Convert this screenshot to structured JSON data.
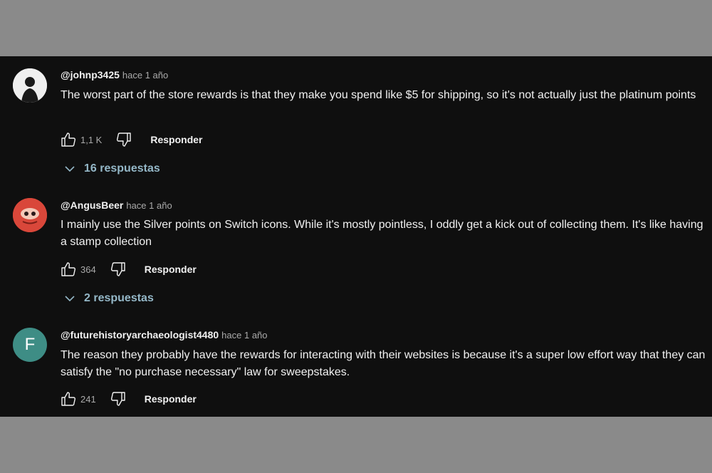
{
  "comments": [
    {
      "author": "@johnp3425",
      "time": "hace 1 año",
      "text": "The worst part of the store rewards is that they make you spend like $5 for shipping, so it's not actually just the platinum points",
      "likes": "1,1 K",
      "reply_label": "Responder",
      "replies_label": "16 respuestas"
    },
    {
      "author": "@AngusBeer",
      "time": "hace 1 año",
      "text": "I mainly use the Silver points on Switch icons. While it's mostly pointless, I oddly get a kick out of collecting them. It's like having a stamp collection",
      "likes": "364",
      "reply_label": "Responder",
      "replies_label": "2 respuestas"
    },
    {
      "author": "@futurehistoryarchaeologist4480",
      "time": "hace 1 año",
      "avatar_letter": "F",
      "text": "The reason they probably have the rewards for interacting with their websites is because it's a super low effort way that they can satisfy the \"no purchase necessary\" law for sweepstakes.",
      "likes": "241",
      "reply_label": "Responder"
    }
  ],
  "colors": {
    "background": "#0f0f0f",
    "frame": "#8a8a8a",
    "text": "#f1f1f1",
    "muted": "#aaaaaa",
    "replies_link": "#94b7c7",
    "avatar_f": "#3e8d85"
  },
  "icons": [
    "thumbs-up-icon",
    "thumbs-down-icon",
    "chevron-down-icon"
  ]
}
